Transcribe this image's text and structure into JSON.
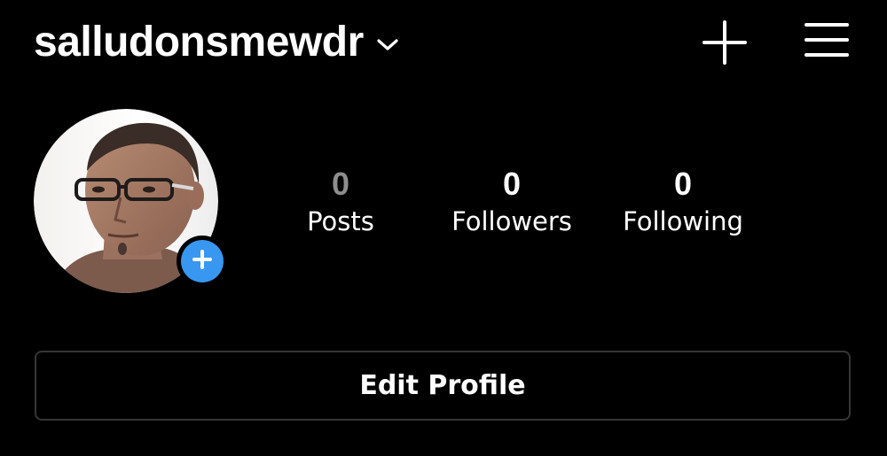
{
  "header": {
    "username": "salludonsmewdr",
    "chevron_icon": "chevron-down-icon",
    "new_post_icon": "plus-icon",
    "menu_icon": "hamburger-menu-icon"
  },
  "profile": {
    "avatar_icon": "profile-photo",
    "add_story_icon": "plus-icon",
    "add_story_color": "#3897f0"
  },
  "stats": {
    "posts": {
      "value": "0",
      "label": "Posts"
    },
    "followers": {
      "value": "0",
      "label": "Followers"
    },
    "following": {
      "value": "0",
      "label": "Following"
    }
  },
  "actions": {
    "edit_profile_label": "Edit Profile"
  },
  "colors": {
    "background": "#000000",
    "text": "#ffffff",
    "muted": "#8e8e8e",
    "border": "#363636",
    "accent": "#3897f0"
  }
}
